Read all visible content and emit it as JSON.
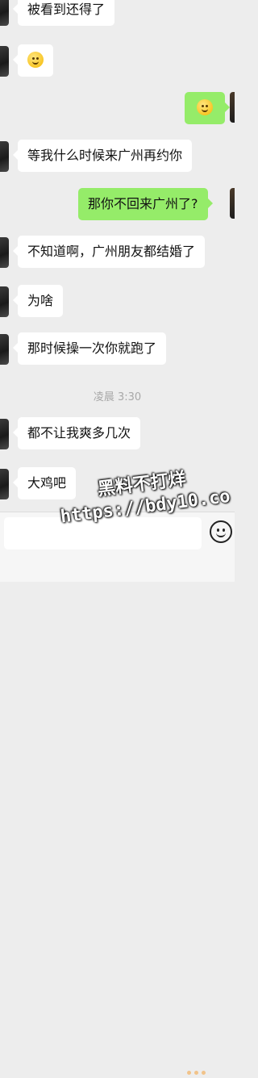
{
  "messages": [
    {
      "side": "left",
      "text": "被看到还得了"
    },
    {
      "side": "left",
      "emoji": "smile-emoji"
    },
    {
      "side": "right",
      "emoji": "smile-emoji"
    },
    {
      "side": "left",
      "text": "等我什么时候来广州再约你"
    },
    {
      "side": "right",
      "text": "那你不回来广州了?"
    },
    {
      "side": "left",
      "text": "不知道啊，广州朋友都结婚了"
    },
    {
      "side": "left",
      "text": "为啥"
    },
    {
      "side": "left",
      "text": "那时候操一次你就跑了"
    },
    {
      "side": "left",
      "text": "都不让我爽多几次"
    },
    {
      "side": "left",
      "text": "大鸡吧"
    }
  ],
  "timestamp": "凌晨 3:30",
  "watermark": {
    "line1": "黑料不打烊",
    "line2": "https://bdy10.co"
  },
  "colors": {
    "sent_bubble": "#95ec69",
    "received_bubble": "#ffffff",
    "background": "#ededed"
  }
}
